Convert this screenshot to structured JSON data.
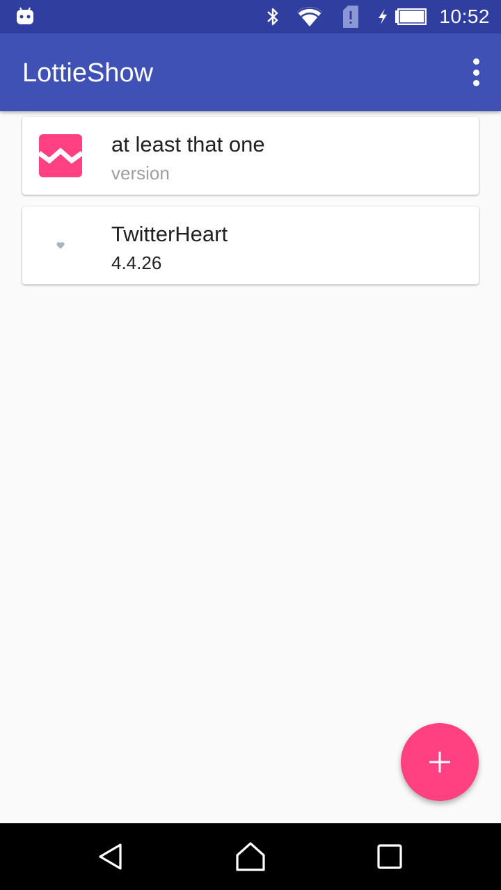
{
  "status_bar": {
    "time": "10:52",
    "icons": [
      "android-icon",
      "bluetooth-icon",
      "wifi-icon",
      "sim-alert-icon",
      "battery-charging-icon"
    ]
  },
  "app_bar": {
    "title": "LottieShow",
    "menu_icon": "overflow-menu-icon"
  },
  "animations": [
    {
      "name": "at least that one",
      "subtitle": "version",
      "thumbnail": "zigzag-thumbnail-icon"
    },
    {
      "name": "TwitterHeart",
      "subtitle": "4.4.26",
      "thumbnail": "heart-icon"
    }
  ],
  "fab": {
    "icon": "plus-icon"
  },
  "nav_bar": {
    "buttons": [
      "back-icon",
      "home-icon",
      "recents-icon"
    ]
  },
  "colors": {
    "primary": "#3f51b5",
    "primary_dark": "#303f9f",
    "accent": "#ff4081",
    "background": "#fafafa"
  }
}
